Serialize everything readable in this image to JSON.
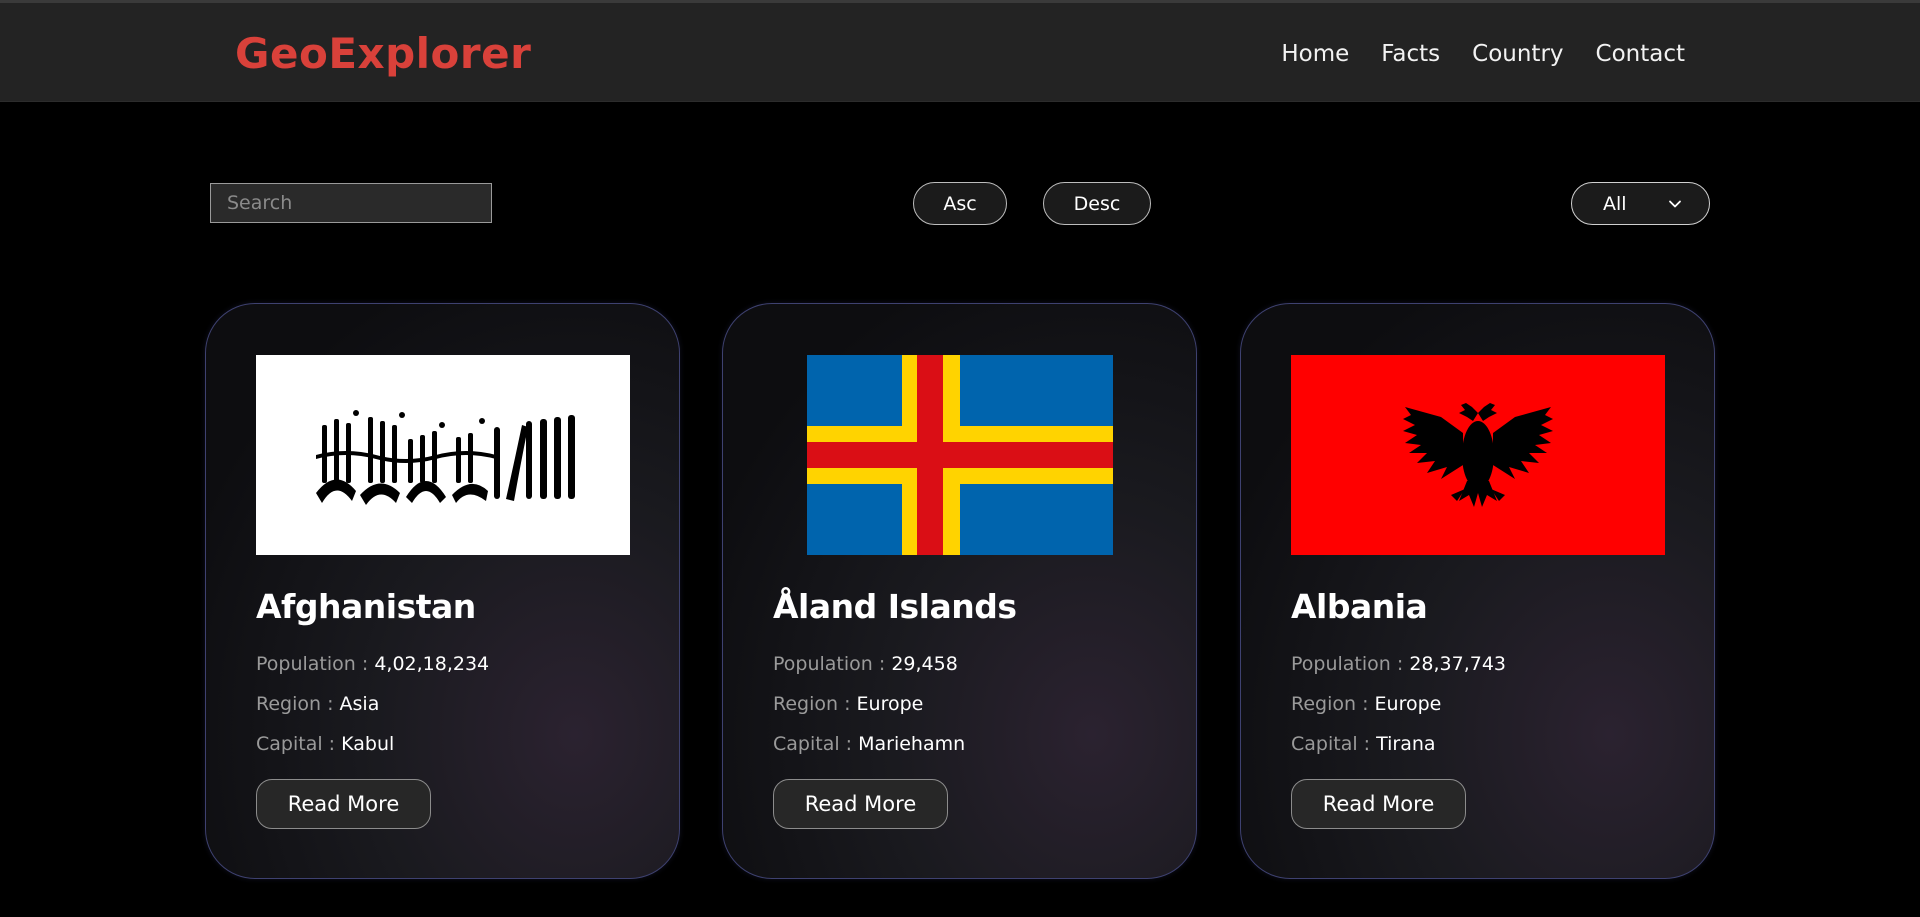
{
  "header": {
    "brand": "GeoExplorer",
    "nav": [
      "Home",
      "Facts",
      "Country",
      "Contact"
    ]
  },
  "controls": {
    "search_placeholder": "Search",
    "asc_label": "Asc",
    "desc_label": "Desc",
    "region_selected": "All"
  },
  "cards": [
    {
      "name": "Afghanistan",
      "population_label": "Population :",
      "population": "4,02,18,234",
      "region_label": "Region :",
      "region": "Asia",
      "capital_label": "Capital :",
      "capital": "Kabul",
      "button": "Read More",
      "flag_icon": "afghanistan-flag-icon"
    },
    {
      "name": "Åland Islands",
      "population_label": "Population :",
      "population": "29,458",
      "region_label": "Region :",
      "region": "Europe",
      "capital_label": "Capital :",
      "capital": "Mariehamn",
      "button": "Read More",
      "flag_icon": "aland-islands-flag-icon"
    },
    {
      "name": "Albania",
      "population_label": "Population :",
      "population": "28,37,743",
      "region_label": "Region :",
      "region": "Europe",
      "capital_label": "Capital :",
      "capital": "Tirana",
      "button": "Read More",
      "flag_icon": "albania-flag-icon"
    }
  ],
  "colors": {
    "brand": "#d9413a",
    "page_background": "#000000",
    "header_background": "#232323",
    "card_border": "#3e4170",
    "label_gray": "#9a9a9a",
    "aland_blue": "#0064AD",
    "aland_yellow": "#FFD300",
    "aland_red": "#DA0E15",
    "albania_red": "#FF0000"
  }
}
